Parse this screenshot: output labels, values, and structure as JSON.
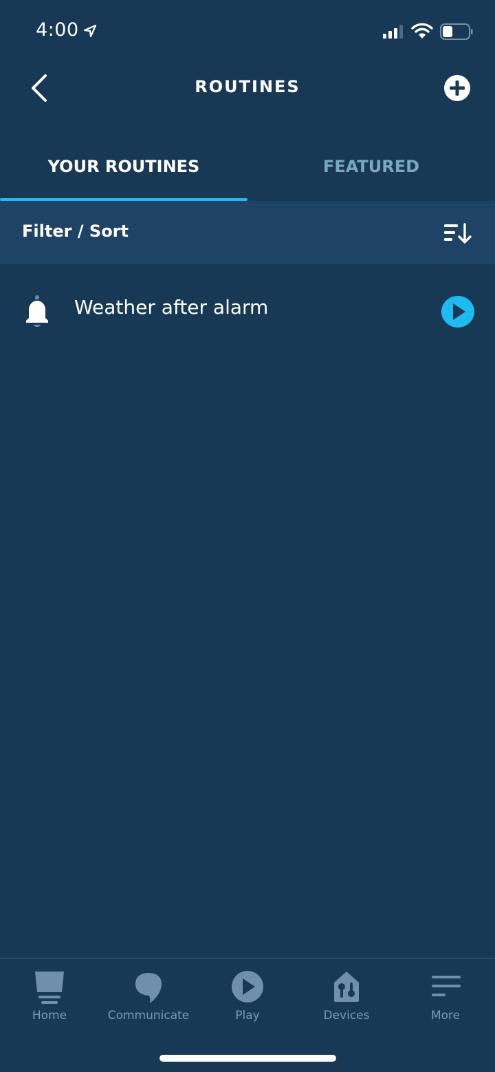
{
  "status_bar": {
    "time": "4:00",
    "location_icon": "location-arrow-icon",
    "signal_icon": "cellular-signal-icon",
    "wifi_icon": "wifi-icon",
    "battery_icon": "battery-icon"
  },
  "header": {
    "title": "ROUTINES",
    "back_icon": "chevron-left-icon",
    "add_icon": "plus-circle-icon"
  },
  "tabs": [
    {
      "label": "YOUR ROUTINES",
      "active": true
    },
    {
      "label": "FEATURED",
      "active": false
    }
  ],
  "filter": {
    "label": "Filter / Sort",
    "icon": "sort-descending-icon"
  },
  "routines": [
    {
      "name": "Weather after alarm",
      "icon": "bell-icon",
      "action_icon": "play-circle-icon"
    }
  ],
  "bottom_nav": [
    {
      "label": "Home",
      "icon": "home-icon"
    },
    {
      "label": "Communicate",
      "icon": "speech-bubble-icon"
    },
    {
      "label": "Play",
      "icon": "play-icon"
    },
    {
      "label": "Devices",
      "icon": "devices-icon"
    },
    {
      "label": "More",
      "icon": "menu-icon"
    }
  ],
  "colors": {
    "background": "#183955",
    "filter_bar": "#1e4364",
    "accent": "#1ebbf0",
    "inactive_tab": "#7ba7c2",
    "nav_inactive": "#7b9bb6"
  }
}
